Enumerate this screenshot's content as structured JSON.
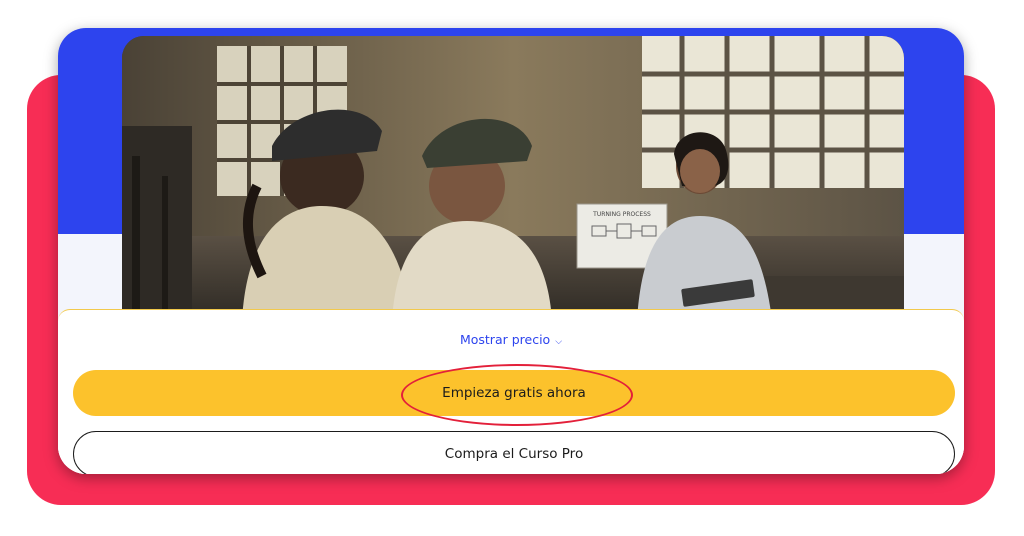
{
  "colors": {
    "accent_blue": "#2d44ee",
    "frame_red": "#f72d55",
    "cta_yellow": "#fcc22c",
    "highlight_red": "#e3203a"
  },
  "hero": {
    "whiteboard_text": "TURNING PROCESS"
  },
  "pricing": {
    "toggle_label": "Mostrar precio",
    "toggle_icon": "chevron-down-icon"
  },
  "actions": {
    "free_label": "Empieza gratis ahora",
    "pro_label": "Compra el Curso Pro"
  }
}
